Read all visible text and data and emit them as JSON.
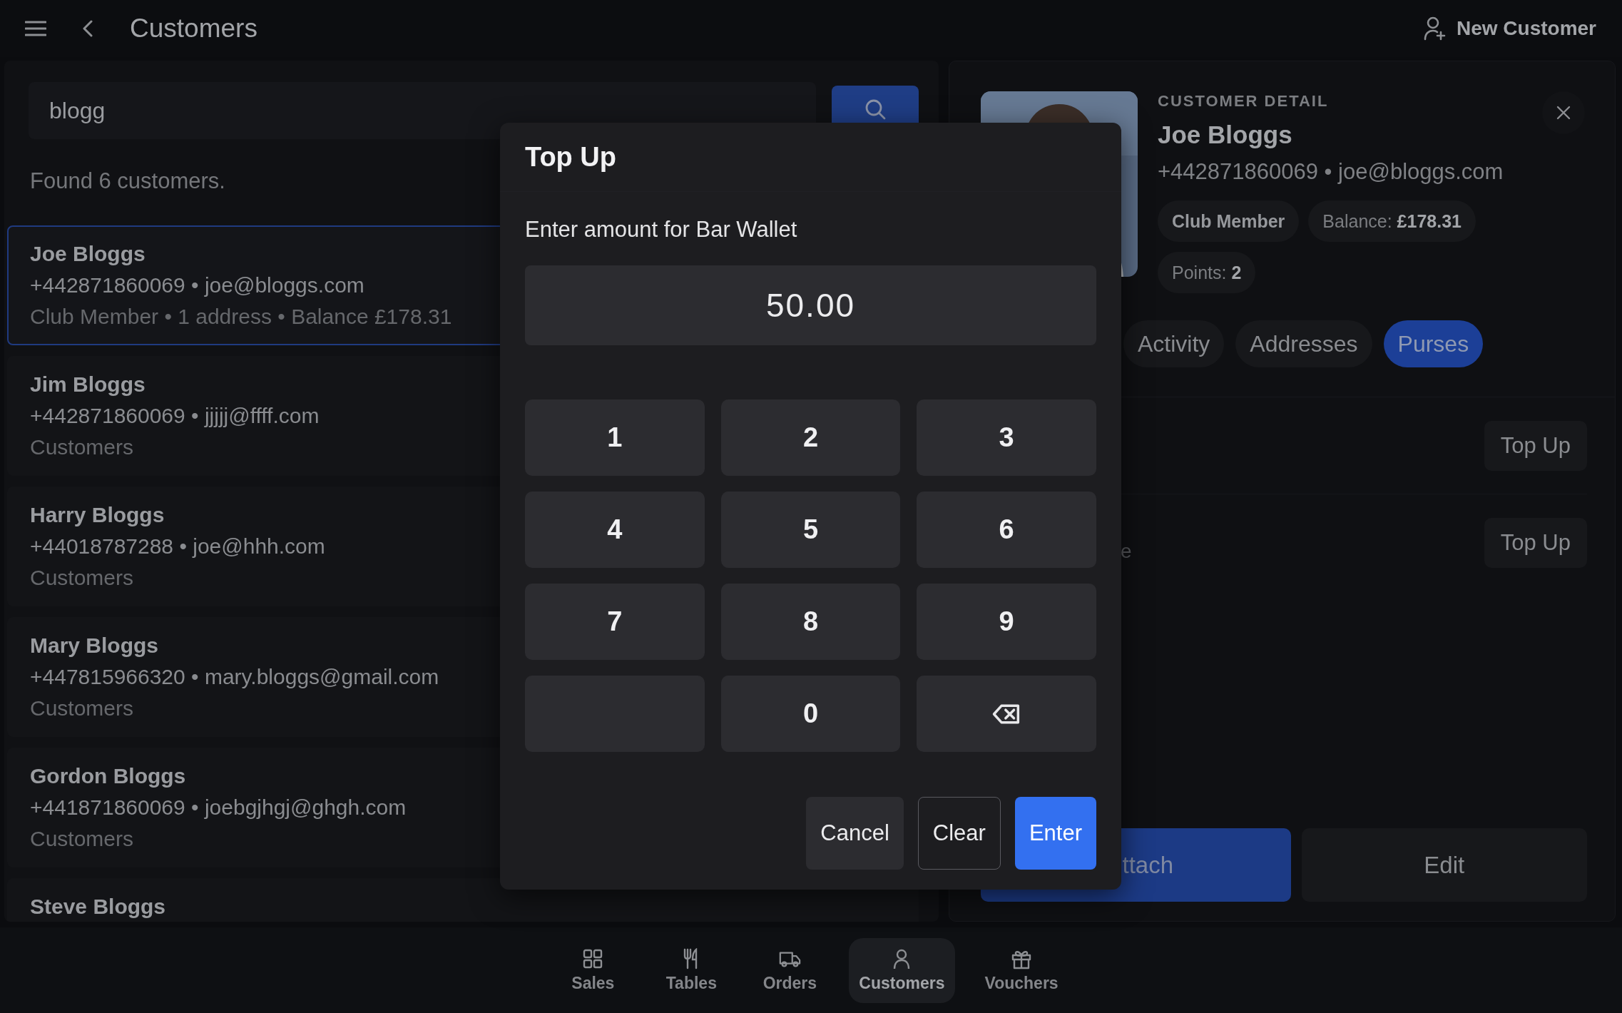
{
  "header": {
    "title": "Customers",
    "action": "New Customer"
  },
  "search": {
    "value": "blogg",
    "result": "Found 6 customers."
  },
  "customers": [
    {
      "name": "Joe Bloggs",
      "contact": "+442871860069 • joe@bloggs.com",
      "meta": "Club Member • 1 address • Balance £178.31",
      "selected": true
    },
    {
      "name": "Jim Bloggs",
      "contact": "+442871860069 • jjjjj@ffff.com",
      "meta": "Customers",
      "selected": false
    },
    {
      "name": "Harry Bloggs",
      "contact": "+44018787288 • joe@hhh.com",
      "meta": "Customers",
      "selected": false
    },
    {
      "name": "Mary Bloggs",
      "contact": "+447815966320 • mary.bloggs@gmail.com",
      "meta": "Customers",
      "selected": false
    },
    {
      "name": "Gordon Bloggs",
      "contact": "+441871860069 • joebgjhgj@ghgh.com",
      "meta": "Customers",
      "selected": false
    },
    {
      "name": "Steve Bloggs",
      "selected": false
    }
  ],
  "detail": {
    "label": "CUSTOMER DETAIL",
    "name": "Joe Bloggs",
    "contact": "+442871860069 • joe@bloggs.com",
    "chips": [
      {
        "text": "Club Member",
        "kind": "tag"
      },
      {
        "text": "Balance: **£178.31**",
        "kind": "stat"
      },
      {
        "text": "Points: **2**",
        "kind": "stat"
      }
    ],
    "tabs": [
      {
        "label": "Activity",
        "selected": false
      },
      {
        "label": "Addresses",
        "selected": false
      },
      {
        "label": "Purses",
        "selected": true
      }
    ],
    "purses": [
      {
        "button": "Top Up"
      },
      {
        "fragment": "e",
        "button": "Top Up"
      }
    ],
    "actions": [
      {
        "label": "ttach",
        "kind": "primary"
      },
      {
        "label": "Edit",
        "kind": "secondary"
      }
    ]
  },
  "dialog": {
    "title": "Top Up",
    "prompt": "Enter amount for Bar Wallet",
    "amount": "50.00",
    "keys": [
      {
        "kind": "digit",
        "label": "1"
      },
      {
        "kind": "digit",
        "label": "2"
      },
      {
        "kind": "digit",
        "label": "3"
      },
      {
        "kind": "digit",
        "label": "4"
      },
      {
        "kind": "digit",
        "label": "5"
      },
      {
        "kind": "digit",
        "label": "6"
      },
      {
        "kind": "digit",
        "label": "7"
      },
      {
        "kind": "digit",
        "label": "8"
      },
      {
        "kind": "digit",
        "label": "9"
      },
      {
        "kind": "blank"
      },
      {
        "kind": "digit",
        "label": "0"
      },
      {
        "kind": "backspace"
      }
    ],
    "buttons": [
      {
        "label": "Cancel",
        "kind": "secondary"
      },
      {
        "label": "Clear",
        "kind": "outline"
      },
      {
        "label": "Enter",
        "kind": "primary"
      }
    ]
  },
  "nav": [
    {
      "label": "Sales",
      "selected": false
    },
    {
      "label": "Tables",
      "selected": false
    },
    {
      "label": "Orders",
      "selected": false
    },
    {
      "label": "Customers",
      "selected": true
    },
    {
      "label": "Vouchers",
      "selected": false
    }
  ]
}
